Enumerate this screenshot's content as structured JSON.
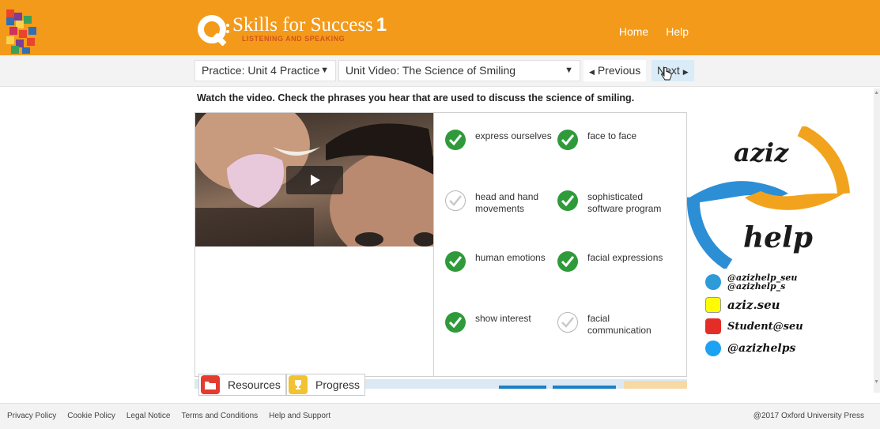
{
  "header": {
    "brand_main": "Skills for Success",
    "brand_level": "1",
    "brand_sub": "LISTENING AND SPEAKING",
    "nav": [
      "Home",
      "Help"
    ]
  },
  "toolbar": {
    "practice_select": "Practice: Unit 4 Practice",
    "activity_select": "Unit Video: The Science of Smiling",
    "previous_label": "Previous",
    "next_label": "Next"
  },
  "activity": {
    "instructions": "Watch the video. Check the phrases you hear that are used to discuss the science of smiling.",
    "options": [
      {
        "label": "express ourselves",
        "checked": true
      },
      {
        "label": "face to face",
        "checked": true
      },
      {
        "label": "head and hand movements",
        "checked": false
      },
      {
        "label": "sophisticated software program",
        "checked": true
      },
      {
        "label": "human emotions",
        "checked": true
      },
      {
        "label": "facial expressions",
        "checked": true
      },
      {
        "label": "show interest",
        "checked": true
      },
      {
        "label": "facial communication",
        "checked": false
      }
    ]
  },
  "bottom_tabs": {
    "resources": "Resources",
    "progress": "Progress"
  },
  "footer": {
    "links": [
      "Privacy Policy",
      "Cookie Policy",
      "Legal Notice",
      "Terms and Conditions",
      "Help and Support"
    ],
    "copyright": "@2017 Oxford University Press"
  },
  "watermark": {
    "word_top": "aziz",
    "word_bottom": "help",
    "telegram_1": "@azizhelp_seu",
    "telegram_2": "@azizhelp_s",
    "snapchat": "aziz.seu",
    "youtube": "Student@seu",
    "twitter": "@azizhelps"
  },
  "colors": {
    "header": "#f39a1b",
    "check_on": "#2f9a3a",
    "next_highlight": "#d9ecf7"
  }
}
